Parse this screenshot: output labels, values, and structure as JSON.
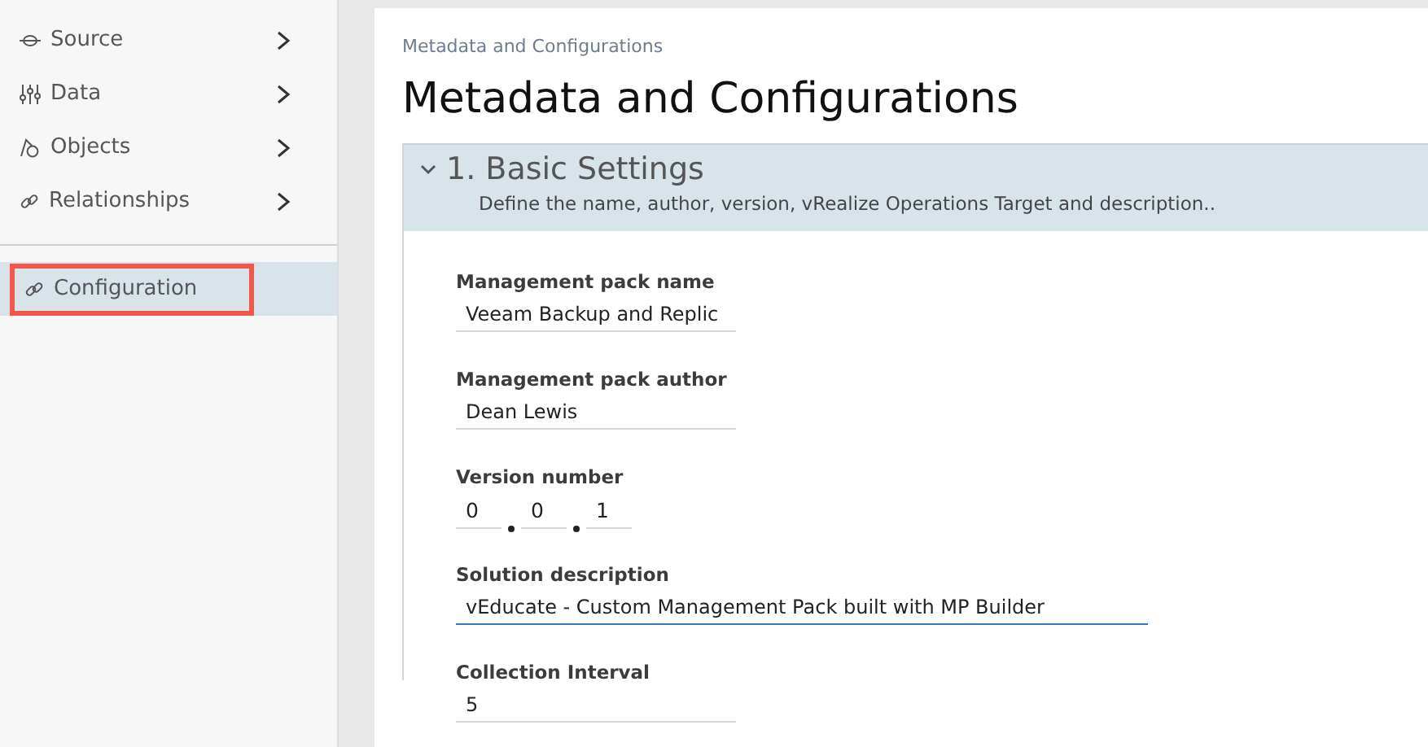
{
  "sidebar": {
    "items": [
      {
        "label": "Source",
        "expandable": true,
        "selected": false,
        "highlighted": false
      },
      {
        "label": "Data",
        "expandable": true,
        "selected": false,
        "highlighted": false
      },
      {
        "label": "Objects",
        "expandable": true,
        "selected": false,
        "highlighted": false
      },
      {
        "label": "Relationships",
        "expandable": true,
        "selected": false,
        "highlighted": false
      },
      {
        "label": "Configuration",
        "expandable": false,
        "selected": true,
        "highlighted": true
      }
    ]
  },
  "main": {
    "breadcrumb": "Metadata and Configurations",
    "title": "Metadata and Configurations",
    "section": {
      "title": "1. Basic Settings",
      "description": "Define the name, author, version, vRealize Operations Target and description..",
      "expanded": true,
      "fields": [
        {
          "kind": "text",
          "label": "Management pack name",
          "value": "Veeam Backup and Replic",
          "focused": false
        },
        {
          "kind": "text",
          "label": "Management pack author",
          "value": "Dean Lewis",
          "focused": false
        },
        {
          "kind": "version",
          "label": "Version number",
          "parts": [
            "0",
            "0",
            "1"
          ]
        },
        {
          "kind": "wide",
          "label": "Solution description",
          "value": "vEducate - Custom Management Pack built with MP Builder",
          "focused": true
        },
        {
          "kind": "text",
          "label": "Collection Interval",
          "value": "5",
          "focused": false
        }
      ]
    }
  }
}
